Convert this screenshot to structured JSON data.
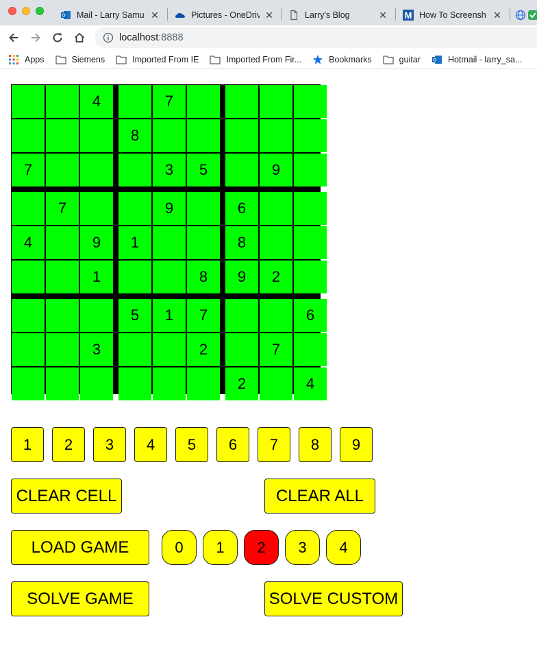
{
  "browser": {
    "tabs": [
      {
        "title": "Mail - Larry Samu",
        "icon": "outlook-icon"
      },
      {
        "title": "Pictures - OneDriv",
        "icon": "onedrive-icon"
      },
      {
        "title": "Larry's Blog",
        "icon": "document-icon"
      },
      {
        "title": "How To Screensh",
        "icon": "m-logo-icon"
      }
    ],
    "close_glyph": "✕",
    "url_host": "localhost",
    "url_port": ":8888",
    "bookmarks": [
      {
        "label": "Apps",
        "icon": "apps-grid-icon"
      },
      {
        "label": "Siemens",
        "icon": "folder-icon"
      },
      {
        "label": "Imported From IE",
        "icon": "folder-icon"
      },
      {
        "label": "Imported From Fir...",
        "icon": "folder-icon"
      },
      {
        "label": "Bookmarks",
        "icon": "star-icon"
      },
      {
        "label": "guitar",
        "icon": "folder-icon"
      },
      {
        "label": "Hotmail - larry_sa...",
        "icon": "outlook-icon"
      }
    ]
  },
  "sudoku": {
    "grid": [
      [
        "",
        "",
        "4",
        "",
        "7",
        "",
        "",
        "",
        ""
      ],
      [
        "",
        "",
        "",
        "8",
        "",
        "",
        "",
        "",
        ""
      ],
      [
        "7",
        "",
        "",
        "",
        "3",
        "5",
        "",
        "9",
        ""
      ],
      [
        "",
        "7",
        "",
        "",
        "9",
        "",
        "6",
        "",
        ""
      ],
      [
        "4",
        "",
        "9",
        "1",
        "",
        "",
        "8",
        "",
        ""
      ],
      [
        "",
        "",
        "1",
        "",
        "",
        "8",
        "9",
        "2",
        ""
      ],
      [
        "",
        "",
        "",
        "5",
        "1",
        "7",
        "",
        "",
        "6"
      ],
      [
        "",
        "",
        "3",
        "",
        "",
        "2",
        "",
        "7",
        ""
      ],
      [
        "",
        "",
        "",
        "",
        "",
        "",
        "2",
        "",
        "4"
      ]
    ],
    "number_buttons": [
      "1",
      "2",
      "3",
      "4",
      "5",
      "6",
      "7",
      "8",
      "9"
    ],
    "clear_cell_label": "CLEAR CELL",
    "clear_all_label": "CLEAR ALL",
    "load_game_label": "LOAD GAME",
    "levels": [
      "0",
      "1",
      "2",
      "3",
      "4"
    ],
    "selected_level": "2",
    "solve_game_label": "SOLVE GAME",
    "solve_custom_label": "SOLVE CUSTOM",
    "colors": {
      "cell": "#00ff00",
      "button": "#ffff00",
      "selected": "#ff0000"
    }
  }
}
